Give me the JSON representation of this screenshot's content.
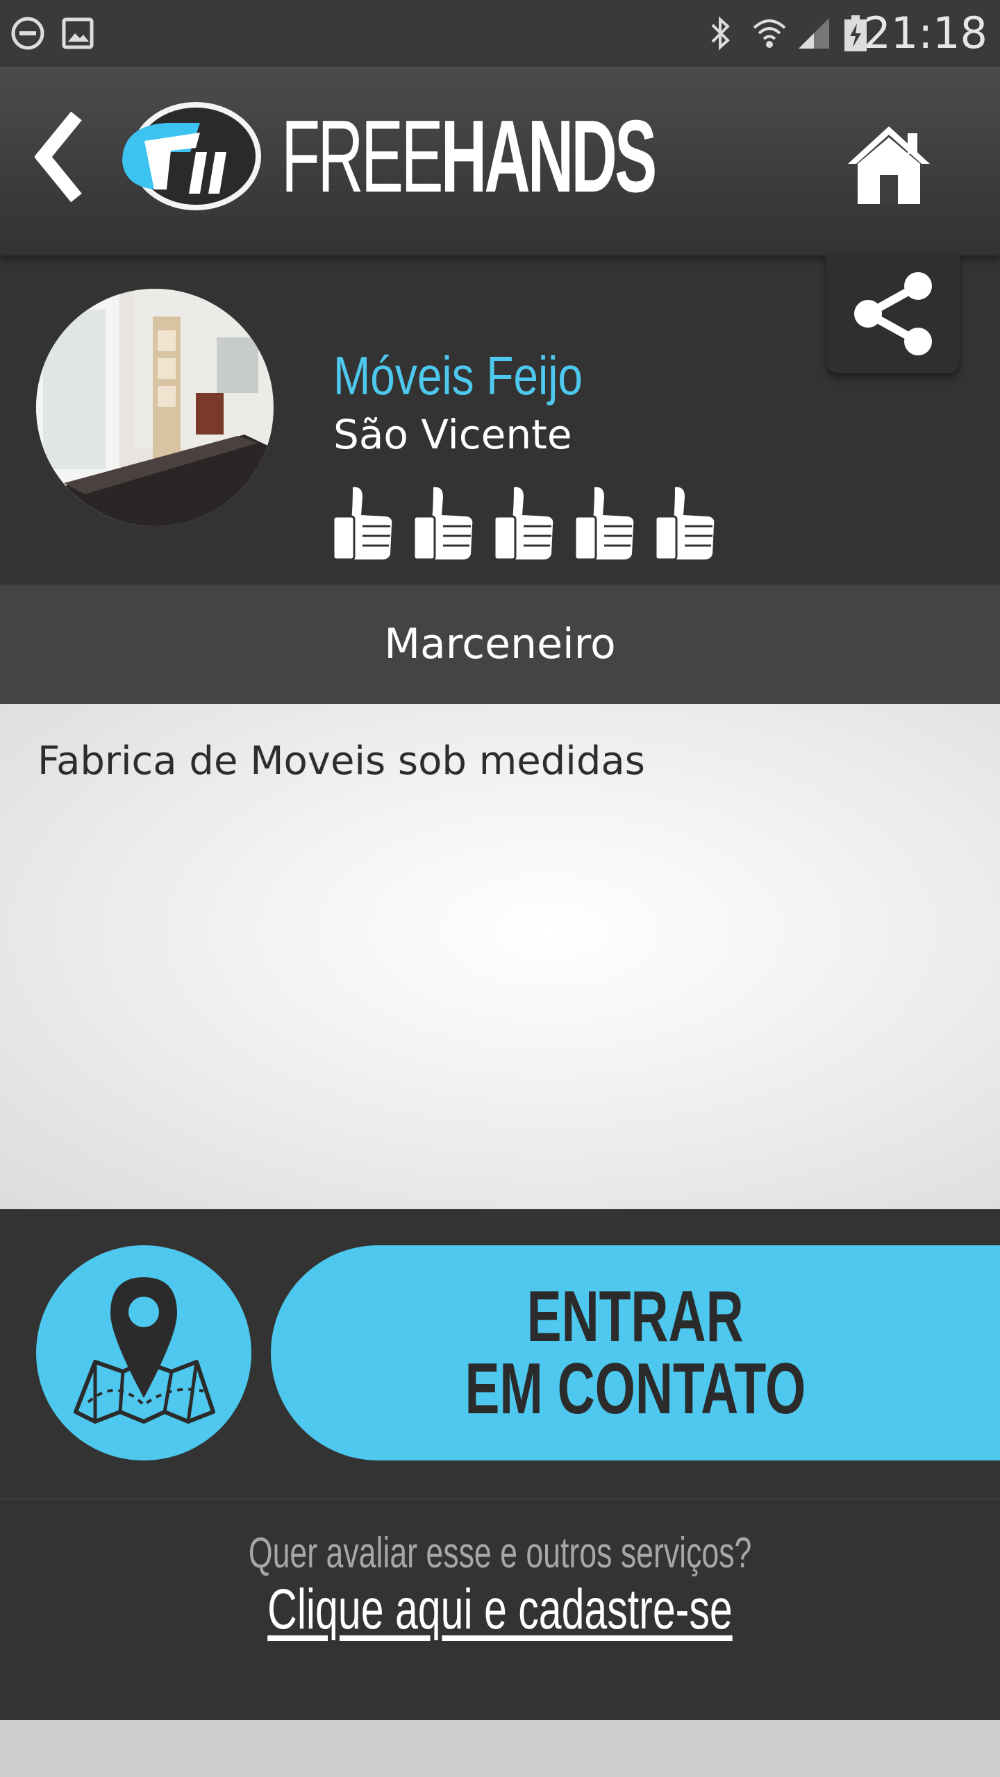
{
  "status_bar": {
    "time": "21:18",
    "icons": [
      "do-not-disturb-icon",
      "image-icon",
      "bluetooth-icon",
      "wifi-icon",
      "signal-icon",
      "battery-charging-icon"
    ]
  },
  "header": {
    "back_icon": "chevron-left-icon",
    "brand_thin": "FREE",
    "brand_bold": "HANDS",
    "home_icon": "home-icon"
  },
  "profile": {
    "name": "Móveis Feijo",
    "city": "São Vicente",
    "rating": 5,
    "rating_max": 5,
    "share_icon": "share-icon"
  },
  "category": "Marceneiro",
  "description": "Fabrica de Moveis sob medidas",
  "actions": {
    "map_icon": "map-pin-icon",
    "contact_line1": "ENTRAR",
    "contact_line2": "EM CONTATO"
  },
  "register": {
    "question": "Quer avaliar esse e outros serviços?",
    "link": "Clique aqui e cadastre-se"
  },
  "colors": {
    "accent": "#4ec8ee",
    "dark": "#333333",
    "header": "#3c3c3c"
  }
}
